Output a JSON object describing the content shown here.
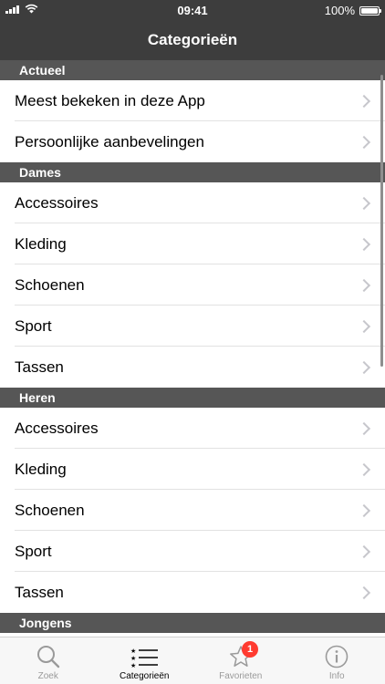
{
  "status_bar": {
    "time": "09:41",
    "battery": "100%",
    "battery_level": 1.0
  },
  "nav_bar": {
    "title": "Categorieën"
  },
  "sections": [
    {
      "header": "Actueel",
      "items": [
        {
          "label": "Meest bekeken in deze App"
        },
        {
          "label": "Persoonlijke aanbevelingen"
        }
      ]
    },
    {
      "header": "Dames",
      "items": [
        {
          "label": "Accessoires"
        },
        {
          "label": "Kleding"
        },
        {
          "label": "Schoenen"
        },
        {
          "label": "Sport"
        },
        {
          "label": "Tassen"
        }
      ]
    },
    {
      "header": "Heren",
      "items": [
        {
          "label": "Accessoires"
        },
        {
          "label": "Kleding"
        },
        {
          "label": "Schoenen"
        },
        {
          "label": "Sport"
        },
        {
          "label": "Tassen"
        }
      ]
    },
    {
      "header": "Jongens",
      "items": []
    }
  ],
  "tab_bar": {
    "items": [
      {
        "label": "Zoek",
        "icon": "search-icon",
        "active": false
      },
      {
        "label": "Categorieën",
        "icon": "list-icon",
        "active": true
      },
      {
        "label": "Favorieten",
        "icon": "star-icon",
        "active": false,
        "badge": "1"
      },
      {
        "label": "Info",
        "icon": "info-icon",
        "active": false
      }
    ]
  },
  "colors": {
    "nav_background": "#3d3d3d",
    "section_header_background": "#565656",
    "badge": "#ff3b30",
    "chevron": "#c7c7cc"
  }
}
